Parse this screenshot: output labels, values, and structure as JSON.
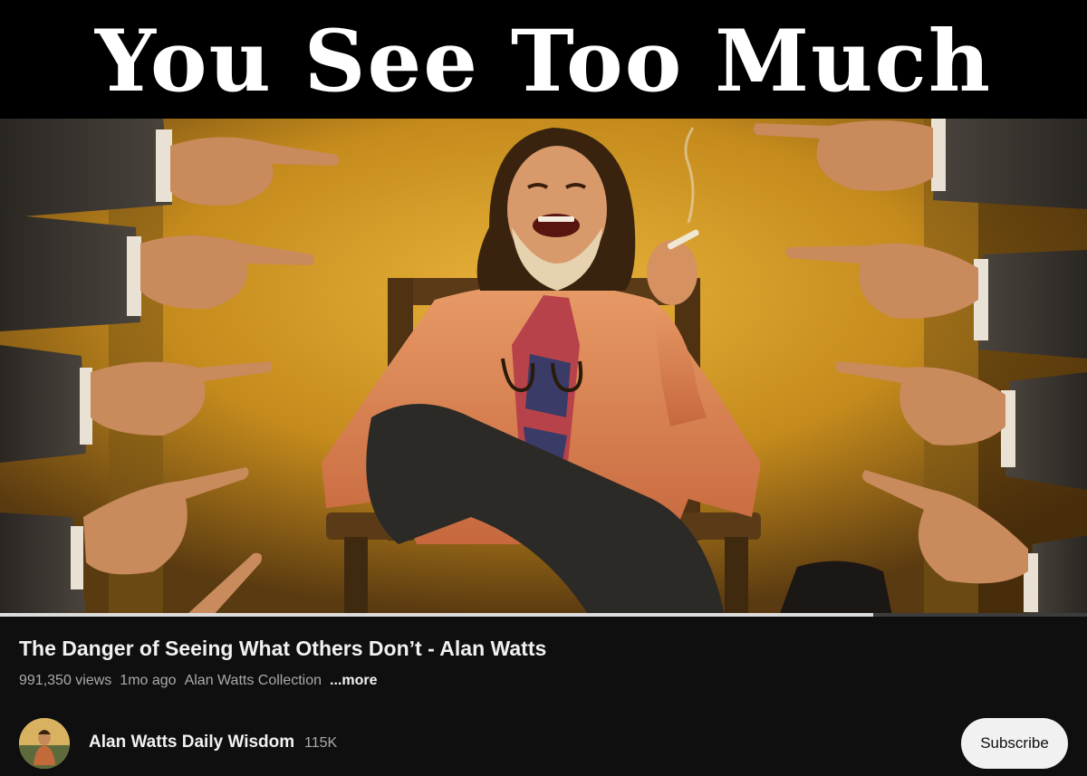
{
  "thumbnail": {
    "headline": "You See Too Much",
    "progress_fraction": 0.803
  },
  "video": {
    "title": "The Danger of Seeing What Others Don’t - Alan Watts",
    "views": "991,350 views",
    "age": "1mo ago",
    "collection": "Alan Watts Collection",
    "more_label": "...more"
  },
  "channel": {
    "name": "Alan Watts Daily Wisdom",
    "subscribers": "115K",
    "subscribe_label": "Subscribe"
  },
  "colors": {
    "background": "#0f0f0f",
    "progress": "#dcdcdc",
    "subscribe_bg": "#f1f1f1",
    "wall": "#c8951e"
  }
}
